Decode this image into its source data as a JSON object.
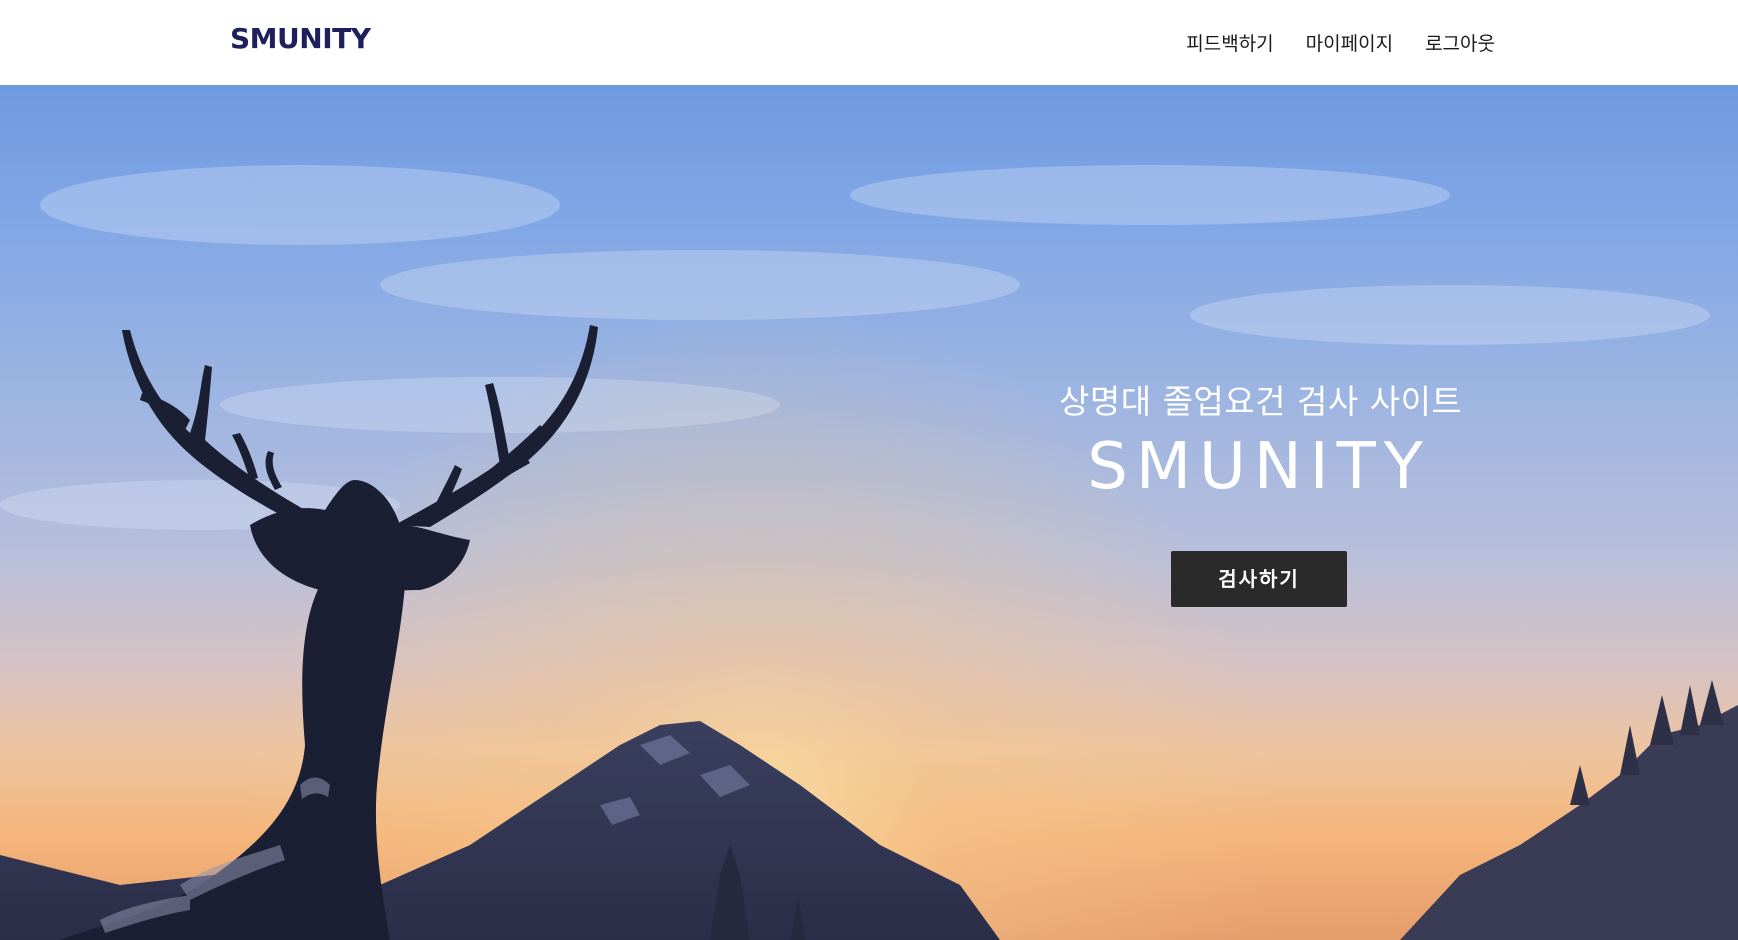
{
  "navbar": {
    "logo": "SMUNITY",
    "links": [
      {
        "label": "피드백하기"
      },
      {
        "label": "마이페이지"
      },
      {
        "label": "로그아웃"
      }
    ]
  },
  "hero": {
    "subtitle": "상명대 졸업요건 검사 사이트",
    "title": "SMUNITY",
    "button_label": "검사하기"
  },
  "colors": {
    "logo": "#1f1f5c",
    "button_bg": "#2a2a2a",
    "hero_text": "#ffffff"
  }
}
